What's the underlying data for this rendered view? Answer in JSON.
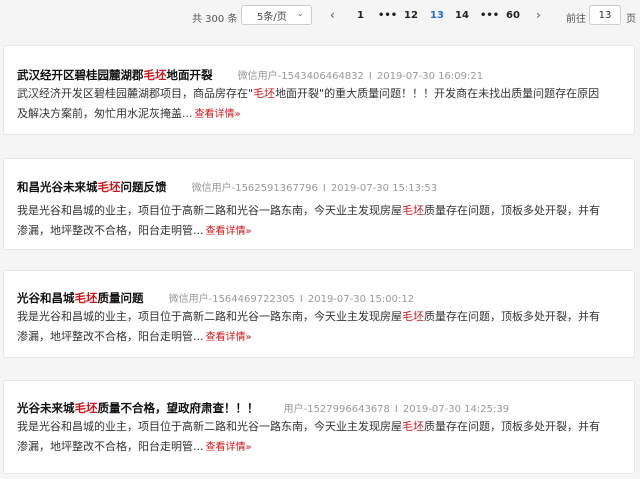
{
  "pagination": {
    "total": "共 300 条",
    "page_size": "5条/页",
    "prev": "‹",
    "next": "›",
    "pages": [
      "1",
      "•••",
      "12",
      "13",
      "14",
      "•••",
      "60"
    ],
    "current": "13",
    "goto_label": "前往",
    "goto_value": "13",
    "goto_suffix": "页"
  },
  "posts": [
    {
      "title_pre": "武汉经开区碧桂园麓湖郡",
      "title_hl": "毛坯",
      "title_post": "地面开裂",
      "author": "微信用户-1543406464832",
      "sep": "I",
      "date": "2019-07-30 16:09:21",
      "line1_pre": "武汉经济开发区碧桂园麓湖郡项目，商品房存在\"",
      "line1_hl": "毛坯",
      "line1_post": "地面开裂\"的重大质量问题！！！开发商在未找出质量问题存在原因",
      "line2": "及解决方案前，匆忙用水泥灰掩盖...",
      "more": "查看详情»"
    },
    {
      "title_pre": "和昌光谷未来城",
      "title_hl": "毛坯",
      "title_post": "问题反馈",
      "author": "微信用户-1562591367796",
      "sep": "I",
      "date": "2019-07-30 15:13:53",
      "line1_pre": "我是光谷和昌城的业主，项目位于高新二路和光谷一路东南，今天业主发现房屋",
      "line1_hl": "毛坯",
      "line1_post": "质量存在问题，顶板多处开裂，并有",
      "line2": "渗漏，地坪整改不合格，阳台走明管...",
      "more": "查看详情»"
    },
    {
      "title_pre": "光谷和昌城",
      "title_hl": "毛坯",
      "title_post": "质量问题",
      "author": "微信用户-1564469722305",
      "sep": "I",
      "date": "2019-07-30 15:00:12",
      "line1_pre": "我是光谷和昌城的业主，项目位于高新二路和光谷一路东南，今天业主发现房屋",
      "line1_hl": "毛坯",
      "line1_post": "质量存在问题，顶板多处开裂，并有",
      "line2": "渗漏，地坪整改不合格，阳台走明管...",
      "more": "查看详情»"
    },
    {
      "title_pre": "光谷未来城",
      "title_hl": "毛坯",
      "title_post": "质量不合格，望政府肃查！！！",
      "author": "用户-1527996643678",
      "sep": "I",
      "date": "2019-07-30 14:25:39",
      "line1_pre": "我是光谷和昌城的业主，项目位于高新二路和光谷一路东南，今天业主发现房屋",
      "line1_hl": "毛坯",
      "line1_post": "质量存在问题，顶板多处开裂，并有",
      "line2": "渗漏，地坪整改不合格，阳台走明管...",
      "more": "查看详情»"
    }
  ]
}
